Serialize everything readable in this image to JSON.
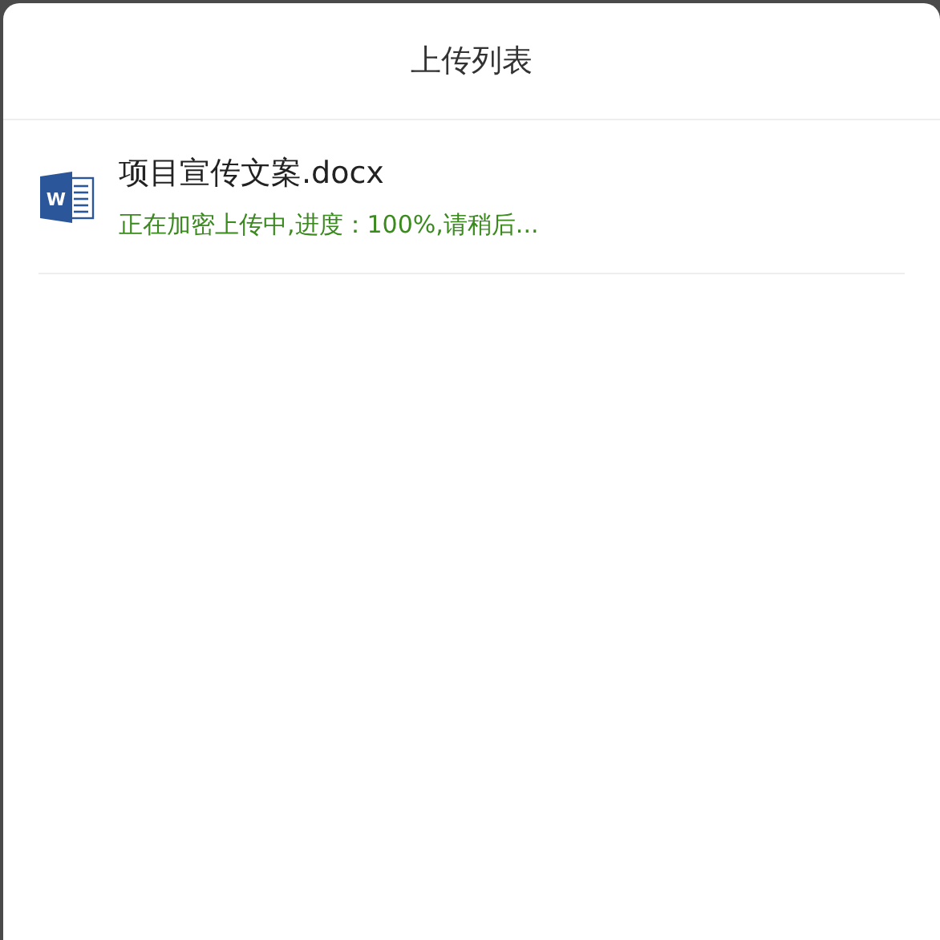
{
  "header": {
    "title": "上传列表"
  },
  "files": [
    {
      "kind": "word",
      "icon_letter": "W",
      "name": "项目宣传文案.docx",
      "status": "正在加密上传中,进度：100%,请稍后..."
    }
  ]
}
